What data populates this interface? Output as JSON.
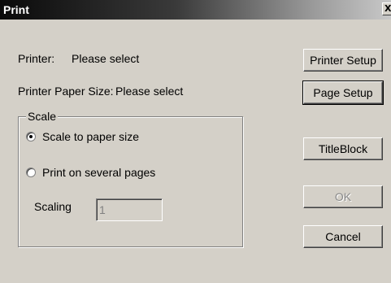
{
  "window": {
    "title": "Print",
    "close_glyph": "X"
  },
  "printer": {
    "label": "Printer:",
    "value": "Please select"
  },
  "paper_size": {
    "label": "Printer Paper Size:",
    "value": "Please select"
  },
  "scale_group": {
    "legend": "Scale",
    "options": [
      {
        "label": "Scale to paper size",
        "selected": true
      },
      {
        "label": "Print on several pages",
        "selected": false
      }
    ],
    "scaling": {
      "label": "Scaling",
      "value": "1",
      "enabled": false
    }
  },
  "buttons": {
    "printer_setup": "Printer Setup",
    "page_setup": "Page Setup",
    "titleblock": "TitleBlock",
    "ok": "OK",
    "cancel": "Cancel"
  },
  "states": {
    "ok_enabled": false,
    "default_button": "Page Setup"
  },
  "colors": {
    "dialog_face": "#d4d0c8",
    "titlebar_text": "#ffffff",
    "disabled_text": "#808080"
  }
}
